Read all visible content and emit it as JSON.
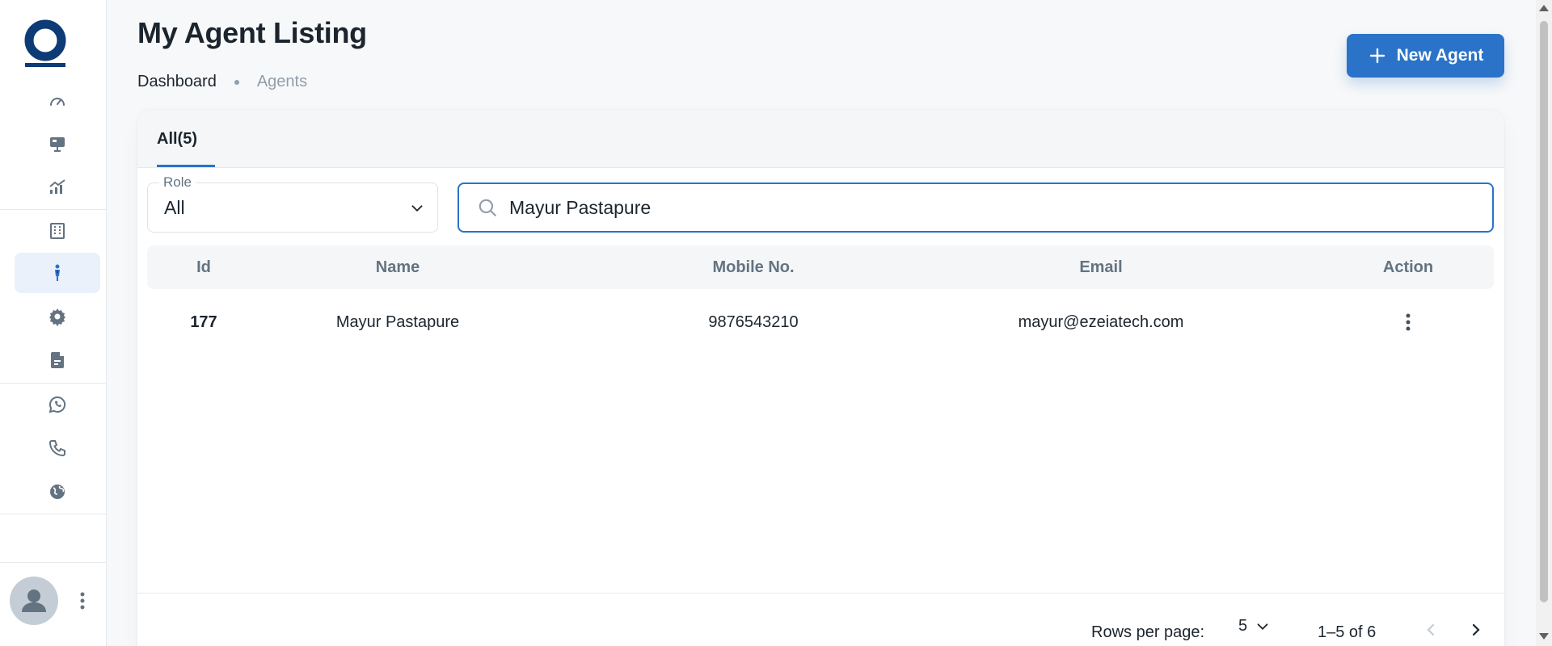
{
  "header": {
    "title": "My Agent Listing",
    "breadcrumb": [
      "Dashboard",
      "Agents"
    ],
    "new_button_label": "New Agent"
  },
  "sidebar": {
    "items": [
      {
        "icon": "dashboard-gauge-icon"
      },
      {
        "icon": "presentation-icon"
      },
      {
        "icon": "analytics-chart-icon"
      },
      {
        "icon": "building-icon"
      },
      {
        "icon": "agent-person-icon",
        "active": true
      },
      {
        "icon": "gear-icon"
      },
      {
        "icon": "document-icon"
      },
      {
        "icon": "whatsapp-icon"
      },
      {
        "icon": "phone-icon"
      },
      {
        "icon": "globe-icon"
      }
    ]
  },
  "tabs": [
    {
      "label": "All(5)",
      "active": true
    }
  ],
  "filters": {
    "role_label": "Role",
    "role_value": "All",
    "search_value": "Mayur Pastapure"
  },
  "table": {
    "columns": [
      "Id",
      "Name",
      "Mobile No.",
      "Email",
      "Action"
    ],
    "rows": [
      {
        "id": "177",
        "name": "Mayur Pastapure",
        "mobile": "9876543210",
        "email": "mayur@ezeiatech.com"
      }
    ]
  },
  "pagination": {
    "rows_per_page_label": "Rows per page:",
    "rows_per_page_value": "5",
    "range": "1–5 of 6"
  },
  "colors": {
    "primary": "#2a73c8",
    "logo": "#0d3b76",
    "text": "#1c252e",
    "muted": "#637381"
  }
}
